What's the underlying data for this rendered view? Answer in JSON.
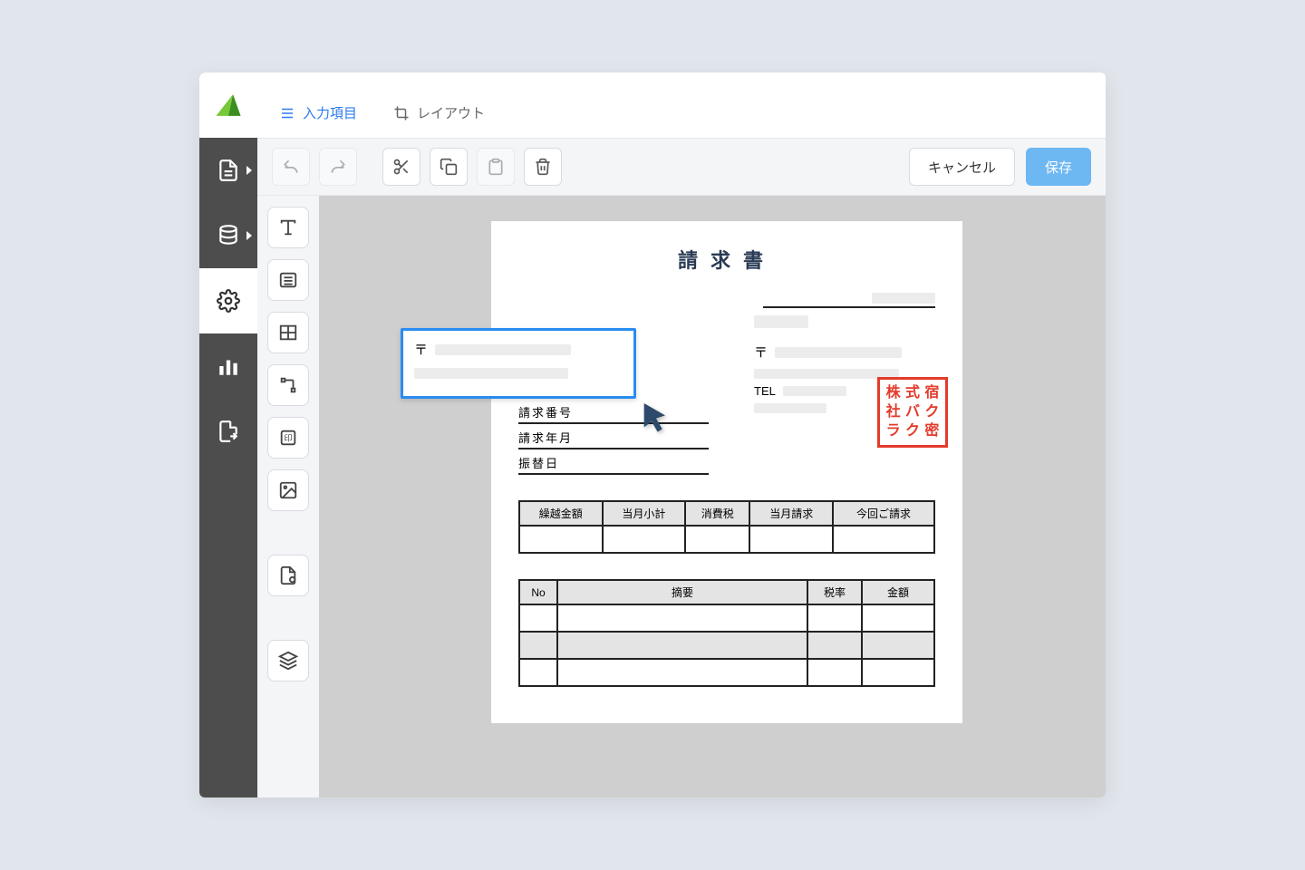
{
  "tabs": {
    "input": "入力項目",
    "layout": "レイアウト"
  },
  "toolbar": {
    "cancel": "キャンセル",
    "save": "保存"
  },
  "document": {
    "title": "請求書",
    "postal_mark": "〒",
    "tel_label": "TEL",
    "left_labels": {
      "invoice_no": "請求番号",
      "invoice_date": "請求年月",
      "transfer_date": "振替日"
    },
    "summary_headers": [
      "繰越金額",
      "当月小計",
      "消費税",
      "当月請求",
      "今回ご請求"
    ],
    "detail_headers": {
      "no": "No",
      "desc": "摘要",
      "rate": "税率",
      "amount": "金額"
    },
    "stamp_chars": [
      "株",
      "式",
      "宿",
      "社",
      "バ",
      "ク",
      "ラ",
      "ク",
      "密"
    ]
  }
}
